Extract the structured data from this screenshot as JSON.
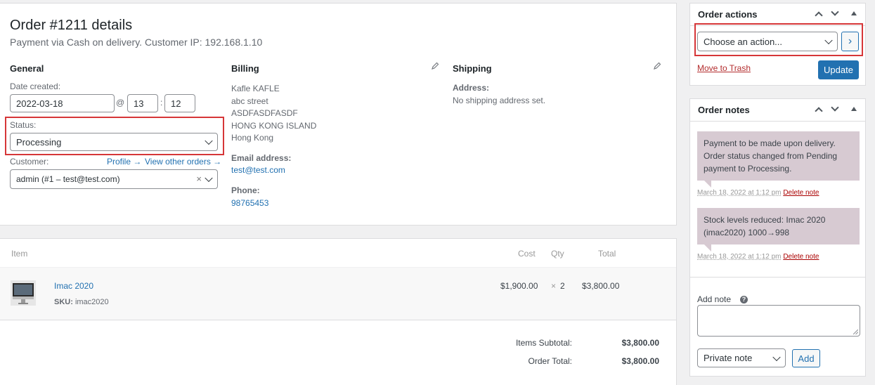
{
  "order": {
    "title": "Order #1211 details",
    "subtitle": "Payment via Cash on delivery. Customer IP: 192.168.1.10"
  },
  "general": {
    "heading": "General",
    "date_label": "Date created:",
    "date_value": "2022-03-18",
    "at": "@",
    "hour": "13",
    "colon": ":",
    "minute": "12",
    "status_label": "Status:",
    "status_value": "Processing",
    "customer_label": "Customer:",
    "profile_link": "Profile →",
    "view_orders_link": "View other orders →",
    "customer_value": "admin (#1 – test@test.com)",
    "clear_symbol": "×"
  },
  "billing": {
    "heading": "Billing",
    "lines": [
      "Kafle KAFLE",
      "abc street",
      "ASDFASDFASDF",
      "HONG KONG ISLAND",
      "Hong Kong"
    ],
    "email_label": "Email address:",
    "email": "test@test.com",
    "phone_label": "Phone:",
    "phone": "98765453"
  },
  "shipping": {
    "heading": "Shipping",
    "address_label": "Address:",
    "address_value": "No shipping address set."
  },
  "items": {
    "headers": {
      "item": "Item",
      "cost": "Cost",
      "qty": "Qty",
      "total": "Total"
    },
    "rows": [
      {
        "name": "Imac 2020",
        "sku_label": "SKU:",
        "sku": "imac2020",
        "cost": "$1,900.00",
        "times": "×",
        "qty": "2",
        "total": "$3,800.00"
      }
    ],
    "subtotal_label": "Items Subtotal:",
    "subtotal": "$3,800.00",
    "total_label": "Order Total:",
    "total": "$3,800.00"
  },
  "actions": {
    "title": "Order actions",
    "select_value": "Choose an action...",
    "go_symbol": "›",
    "trash": "Move to Trash",
    "update": "Update"
  },
  "notes": {
    "title": "Order notes",
    "items": [
      {
        "text": "Payment to be made upon delivery. Order status changed from Pending payment to Processing.",
        "date": "March 18, 2022 at 1:12 pm",
        "delete": "Delete note"
      },
      {
        "text": "Stock levels reduced: Imac 2020 (imac2020) 1000→998",
        "date": "March 18, 2022 at 1:12 pm",
        "delete": "Delete note"
      }
    ],
    "add_label": "Add note",
    "help_symbol": "?",
    "type_value": "Private note",
    "add_button": "Add"
  },
  "colors": {
    "accent": "#2271b1",
    "highlight": "#d63638",
    "note_bg": "#d7cad2"
  }
}
